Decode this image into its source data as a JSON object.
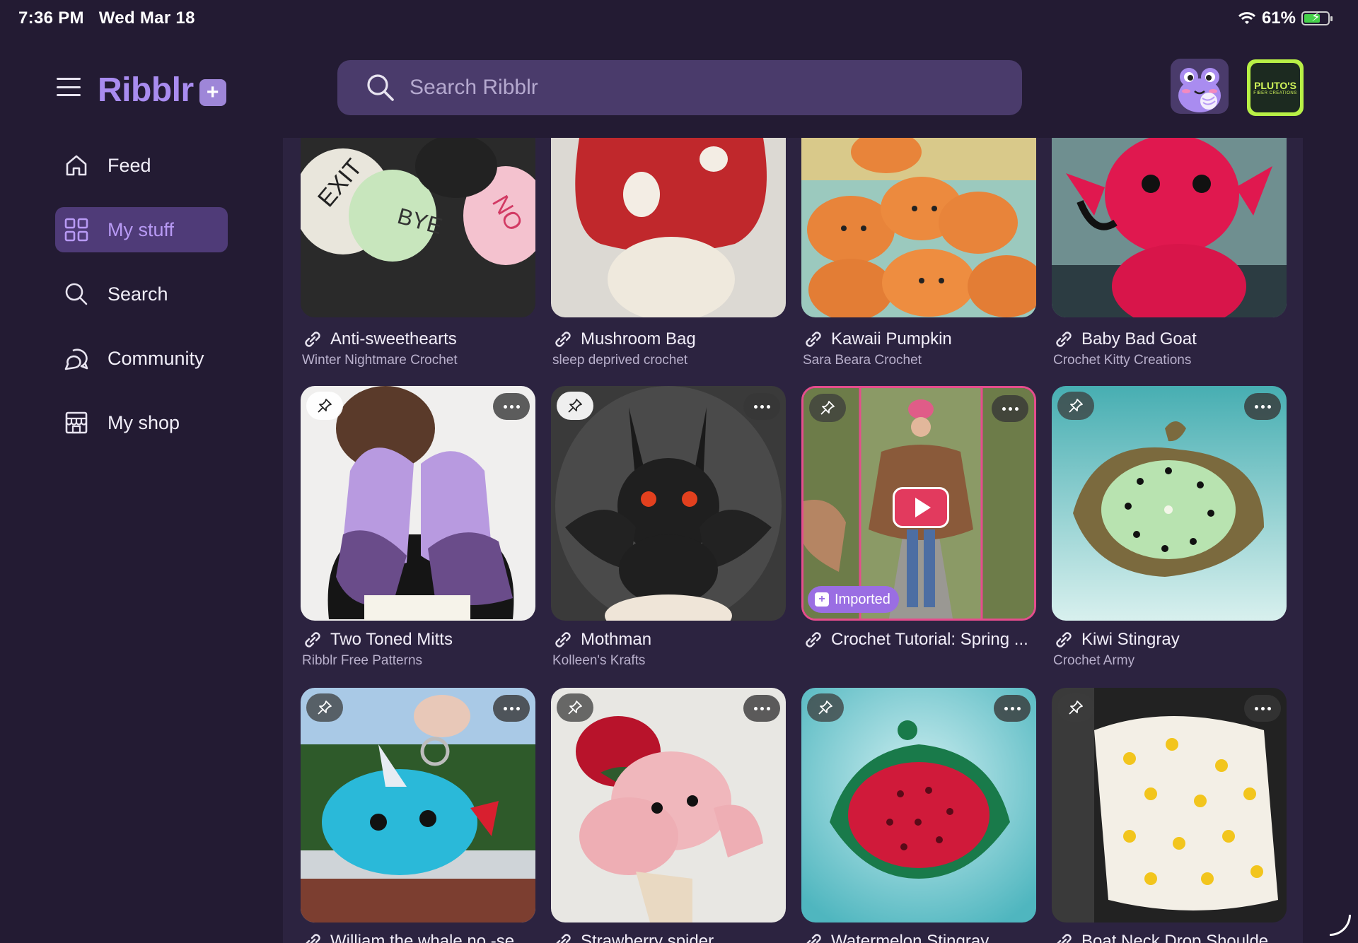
{
  "status_bar": {
    "time": "7:36 PM",
    "date": "Wed Mar 18",
    "battery": "61%",
    "battery_level": 0.61
  },
  "app": {
    "logo_text": "Ribblr",
    "logo_badge": "+"
  },
  "sidebar": {
    "items": [
      {
        "label": "Feed",
        "icon": "home-icon",
        "active": false
      },
      {
        "label": "My stuff",
        "icon": "grid-icon",
        "active": true
      },
      {
        "label": "Search",
        "icon": "search-icon",
        "active": false
      },
      {
        "label": "Community",
        "icon": "chat-bubbles-icon",
        "active": false
      },
      {
        "label": "My shop",
        "icon": "shop-icon",
        "active": false
      }
    ]
  },
  "header": {
    "search_placeholder": "Search Ribblr"
  },
  "avatars": {
    "brand_text": "PLUTO'S",
    "brand_sub": "FIBER CREATIONS"
  },
  "colors": {
    "background": "#231b33",
    "panel": "#2c2340",
    "accent": "#a98cf0",
    "active_nav": "#4f3b78",
    "imported_badge": "#9a6ee3"
  },
  "patterns": [
    {
      "title": "Anti-sweethearts",
      "creator": "Winter Nightmare Crochet"
    },
    {
      "title": "Mushroom Bag",
      "creator": "sleep deprived crochet"
    },
    {
      "title": "Kawaii Pumpkin",
      "creator": "Sara Beara Crochet"
    },
    {
      "title": "Baby Bad Goat",
      "creator": "Crochet Kitty Creations"
    },
    {
      "title": "Two Toned Mitts",
      "creator": "Ribblr Free Patterns"
    },
    {
      "title": "Mothman",
      "creator": "Kolleen's Krafts"
    },
    {
      "title": "Crochet Tutorial: Spring ...",
      "creator": "",
      "badge": "Imported"
    },
    {
      "title": "Kiwi Stingray",
      "creator": "Crochet Army"
    },
    {
      "title": "William the whale no -se...",
      "creator": ""
    },
    {
      "title": "Strawberry spider",
      "creator": ""
    },
    {
      "title": "Watermelon Stingray",
      "creator": ""
    },
    {
      "title": "Boat Neck Drop Shoulde...",
      "creator": ""
    }
  ]
}
